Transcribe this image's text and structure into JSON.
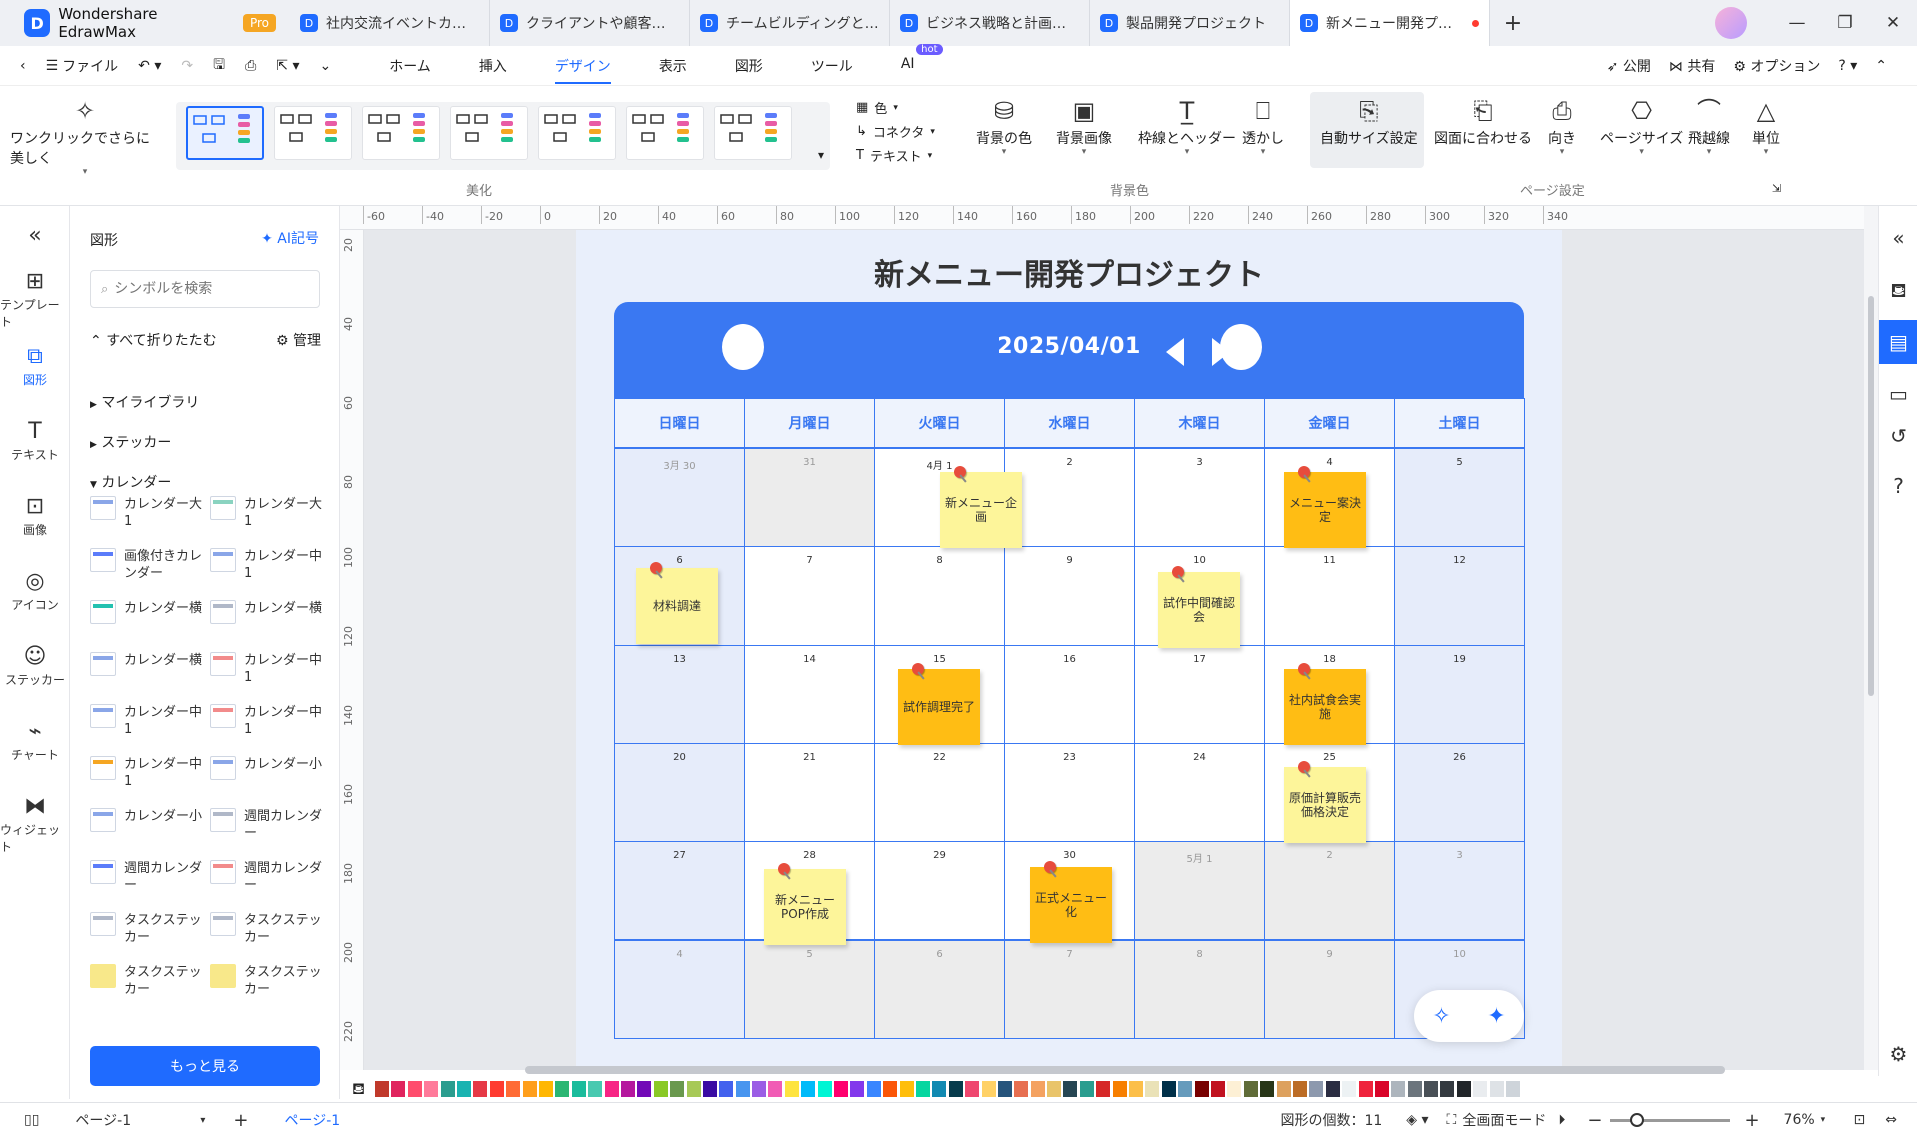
{
  "app": {
    "name": "Wondershare EdrawMax",
    "badge": "Pro"
  },
  "tabs": [
    {
      "label": "社内交流イベントカレン..."
    },
    {
      "label": "クライアントや顧客対応..."
    },
    {
      "label": "チームビルディングと人材..."
    },
    {
      "label": "ビジネス戦略と計画の..."
    },
    {
      "label": "製品開発プロジェクト"
    },
    {
      "label": "新メニュー開発プロジ...",
      "active": true
    }
  ],
  "menubar": {
    "file": "ファイル",
    "tabs": [
      "ホーム",
      "挿入",
      "デザイン",
      "表示",
      "図形",
      "ツール",
      "AI"
    ],
    "active_tab": "デザイン",
    "ai_badge": "hot",
    "publish": "公開",
    "share": "共有",
    "options": "オプション"
  },
  "ribbon": {
    "one_click": "ワンクリックでさらに美しく",
    "color": "色",
    "connector": "コネクタ",
    "text": "テキスト",
    "bg_color": "背景の色",
    "bg_image": "背景画像",
    "border_header": "枠線とヘッダー",
    "watermark": "透かし",
    "auto_size": "自動サイズ設定",
    "fit_drawing": "図面に合わせる",
    "orientation": "向き",
    "page_size": "ページサイズ",
    "jump_line": "飛越線",
    "unit": "単位",
    "group_beautify": "美化",
    "group_background": "背景色",
    "group_page_setup": "ページ設定"
  },
  "rail": [
    {
      "label": "テンプレート",
      "icon": "template-icon"
    },
    {
      "label": "図形",
      "icon": "shapes-icon",
      "active": true
    },
    {
      "label": "テキスト",
      "icon": "text-icon"
    },
    {
      "label": "画像",
      "icon": "image-icon"
    },
    {
      "label": "アイコン",
      "icon": "icon-library-icon"
    },
    {
      "label": "ステッカー",
      "icon": "sticker-icon"
    },
    {
      "label": "チャート",
      "icon": "chart-icon"
    },
    {
      "label": "ウィジェット",
      "icon": "widget-icon"
    }
  ],
  "panel": {
    "title": "図形",
    "ai_symbol": "AI記号",
    "search_placeholder": "シンボルを検索",
    "collapse_all": "すべて折りたたむ",
    "manage": "管理",
    "libraries": [
      "マイライブラリ",
      "ステッカー",
      "カレンダー"
    ],
    "shapes": [
      "カレンダー大1",
      "カレンダー大1",
      "画像付きカレンダー",
      "カレンダー中1",
      "カレンダー横",
      "カレンダー横",
      "カレンダー横",
      "カレンダー中1",
      "カレンダー中1",
      "カレンダー中1",
      "カレンダー中1",
      "カレンダー小",
      "カレンダー小",
      "週間カレンダー",
      "週間カレンダー",
      "週間カレンダー",
      "タスクステッカー",
      "タスクステッカー",
      "タスクステッカー",
      "タスクステッカー"
    ],
    "more": "もっと見る"
  },
  "ruler": {
    "h": [
      "-60",
      "-40",
      "-20",
      "0",
      "20",
      "40",
      "60",
      "80",
      "100",
      "120",
      "140",
      "160",
      "180",
      "200",
      "220",
      "240",
      "260",
      "280",
      "300",
      "320",
      "340"
    ],
    "v": [
      "20",
      "40",
      "60",
      "80",
      "100",
      "120",
      "140",
      "160",
      "180",
      "200",
      "220"
    ]
  },
  "document": {
    "title": "新メニュー開発プロジェクト",
    "date": "2025/04/01",
    "weekdays": [
      "日曜日",
      "月曜日",
      "火曜日",
      "水曜日",
      "木曜日",
      "金曜日",
      "土曜日"
    ],
    "days": [
      "3月 30",
      "31",
      "4月 1",
      "2",
      "3",
      "4",
      "5",
      "6",
      "7",
      "8",
      "9",
      "10",
      "11",
      "12",
      "13",
      "14",
      "15",
      "16",
      "17",
      "18",
      "19",
      "20",
      "21",
      "22",
      "23",
      "24",
      "25",
      "26",
      "27",
      "28",
      "29",
      "30",
      "5月 1",
      "2",
      "3",
      "4",
      "5",
      "6",
      "7",
      "8",
      "9",
      "10"
    ],
    "notes": [
      {
        "text": "新メニュー企画",
        "color": "yellow"
      },
      {
        "text": "メニュー案決定",
        "color": "orange"
      },
      {
        "text": "材料調達",
        "color": "yellow"
      },
      {
        "text": "試作中間確認会",
        "color": "yellow"
      },
      {
        "text": "試作調理完了",
        "color": "orange"
      },
      {
        "text": "社内試食会実施",
        "color": "orange"
      },
      {
        "text": "原価計算販売価格決定",
        "color": "yellow"
      },
      {
        "text": "新メニューPOP作成",
        "color": "yellow"
      },
      {
        "text": "正式メニュー化",
        "color": "orange"
      }
    ],
    "colors": {
      "accent": "#3a78f2",
      "yellow_note": "#fdf59a",
      "orange_note": "#ffbd14"
    }
  },
  "palette": [
    "#c0392b",
    "#e0245e",
    "#ff4d6d",
    "#ff7a9a",
    "#2a9d8f",
    "#19b3b1",
    "#e63946",
    "#ff3b30",
    "#ff6b35",
    "#ff9f1c",
    "#ffb703",
    "#2bb673",
    "#1abc9c",
    "#48c9b0",
    "#f72585",
    "#b5179e",
    "#7209b7",
    "#8ac926",
    "#6a994e",
    "#a7c957",
    "#3a0ca3",
    "#4361ee",
    "#4895ef",
    "#9b5de5",
    "#f15bb5",
    "#fee440",
    "#00bbf9",
    "#00f5d4",
    "#ff006e",
    "#8338ec",
    "#3a86ff",
    "#fb5607",
    "#ffbe0b",
    "#06d6a0",
    "#118ab2",
    "#073b4c",
    "#ef476f",
    "#ffd166",
    "#26547c",
    "#e76f51",
    "#f4a261",
    "#e9c46a",
    "#264653",
    "#2a9d8f",
    "#d62828",
    "#f77f00",
    "#fcbf49",
    "#eae2b7",
    "#003049",
    "#669bbc",
    "#780000",
    "#c1121f",
    "#fdf0d5",
    "#606c38",
    "#283618",
    "#dda15e",
    "#bc6c25",
    "#8d99ae",
    "#2b2d42",
    "#edf2f4",
    "#ef233c",
    "#d90429",
    "#adb5bd",
    "#6c757d",
    "#495057",
    "#343a40",
    "#212529",
    "#e9ecef",
    "#dee2e6",
    "#ced4da"
  ],
  "status": {
    "page_menu": "ページ-1",
    "page_tab": "ページ-1",
    "shape_count": "図形の個数：11",
    "fullscreen": "全画面モード",
    "zoom": "76%"
  }
}
